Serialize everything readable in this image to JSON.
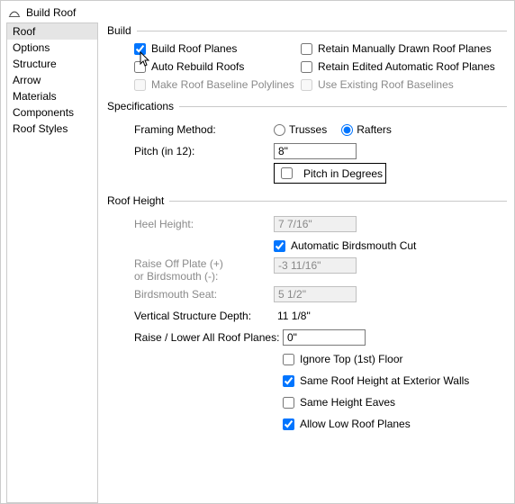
{
  "window": {
    "title": "Build Roof"
  },
  "sidebar": {
    "items": [
      {
        "label": "Roof"
      },
      {
        "label": "Options"
      },
      {
        "label": "Structure"
      },
      {
        "label": "Arrow"
      },
      {
        "label": "Materials"
      },
      {
        "label": "Components"
      },
      {
        "label": "Roof Styles"
      }
    ],
    "selected": 0
  },
  "build": {
    "legend": "Build",
    "build_roof_planes": "Build Roof Planes",
    "auto_rebuild_roofs": "Auto Rebuild Roofs",
    "make_baseline_polylines": "Make Roof Baseline Polylines",
    "retain_manual_planes": "Retain Manually Drawn Roof Planes",
    "retain_edited_auto_planes": "Retain Edited Automatic Roof Planes",
    "use_existing_baselines": "Use Existing Roof Baselines"
  },
  "specs": {
    "legend": "Specifications",
    "framing_method_label": "Framing Method:",
    "trusses": "Trusses",
    "rafters": "Rafters",
    "pitch_label": "Pitch (in 12):",
    "pitch_value": "8\"",
    "pitch_in_degrees": "Pitch in Degrees"
  },
  "roof_height": {
    "legend": "Roof Height",
    "heel_height_label": "Heel Height:",
    "heel_height_value": "7 7/16\"",
    "auto_birdsmouth": "Automatic Birdsmouth Cut",
    "raise_off_plate_label1": "Raise Off Plate (+)",
    "raise_off_plate_label2": "or Birdsmouth (-):",
    "raise_off_plate_value": "-3 11/16\"",
    "birdsmouth_seat_label": "Birdsmouth Seat:",
    "birdsmouth_seat_value": "5 1/2\"",
    "vert_struct_depth_label": "Vertical Structure Depth:",
    "vert_struct_depth_value": "11 1/8\"",
    "raise_lower_label": "Raise / Lower All Roof Planes:",
    "raise_lower_value": "0\"",
    "ignore_top_floor": "Ignore Top (1st) Floor",
    "same_roof_height_ext": "Same Roof Height at Exterior Walls",
    "same_height_eaves": "Same Height Eaves",
    "allow_low_roof_planes": "Allow Low Roof Planes"
  }
}
